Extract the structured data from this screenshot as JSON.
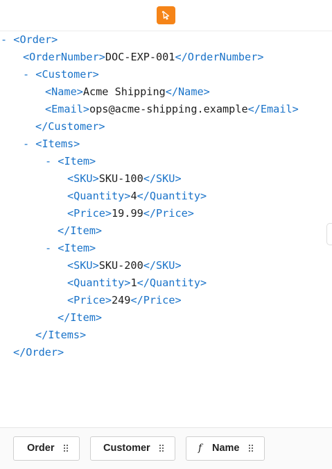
{
  "toolbar": {
    "pick_icon": "cursor-select-icon",
    "accent_color": "#f58418"
  },
  "xml": {
    "lines": [
      {
        "toggle": "- ",
        "open": "<Order>",
        "text": "",
        "close": ""
      },
      {
        "toggle": "",
        "open": "<OrderNumber>",
        "text": "DOC-EXP-001",
        "close": "</OrderNumber>"
      },
      {
        "toggle": "- ",
        "open": "<Customer>",
        "text": "",
        "close": ""
      },
      {
        "toggle": "",
        "open": "<Name>",
        "text": "Acme Shipping",
        "close": "</Name>"
      },
      {
        "toggle": "",
        "open": "<Email>",
        "text": "ops@acme-shipping.example",
        "close": "</Email>"
      },
      {
        "toggle": "",
        "open": "",
        "text": "",
        "close": "</Customer>"
      },
      {
        "toggle": "- ",
        "open": "<Items>",
        "text": "",
        "close": ""
      },
      {
        "toggle": "- ",
        "open": "<Item>",
        "text": "",
        "close": ""
      },
      {
        "toggle": "",
        "open": "<SKU>",
        "text": "SKU-100",
        "close": "</SKU>"
      },
      {
        "toggle": "",
        "open": "<Quantity>",
        "text": "4",
        "close": "</Quantity>"
      },
      {
        "toggle": "",
        "open": "<Price>",
        "text": "19.99",
        "close": "</Price>"
      },
      {
        "toggle": "",
        "open": "",
        "text": "",
        "close": "</Item>"
      },
      {
        "toggle": "- ",
        "open": "<Item>",
        "text": "",
        "close": ""
      },
      {
        "toggle": "",
        "open": "<SKU>",
        "text": "SKU-200",
        "close": "</SKU>"
      },
      {
        "toggle": "",
        "open": "<Quantity>",
        "text": "1",
        "close": "</Quantity>"
      },
      {
        "toggle": "",
        "open": "<Price>",
        "text": "249",
        "close": "</Price>"
      },
      {
        "toggle": "",
        "open": "",
        "text": "",
        "close": "</Item>"
      },
      {
        "toggle": "",
        "open": "",
        "text": "",
        "close": "</Items>"
      },
      {
        "toggle": "",
        "open": "",
        "text": "",
        "close": "</Order>"
      }
    ]
  },
  "fields": {
    "order_label": "Order",
    "customer_label": "Customer",
    "name_label": "Name",
    "name_function_symbol": "f",
    "grip_icon": "drag-grip-icon"
  }
}
